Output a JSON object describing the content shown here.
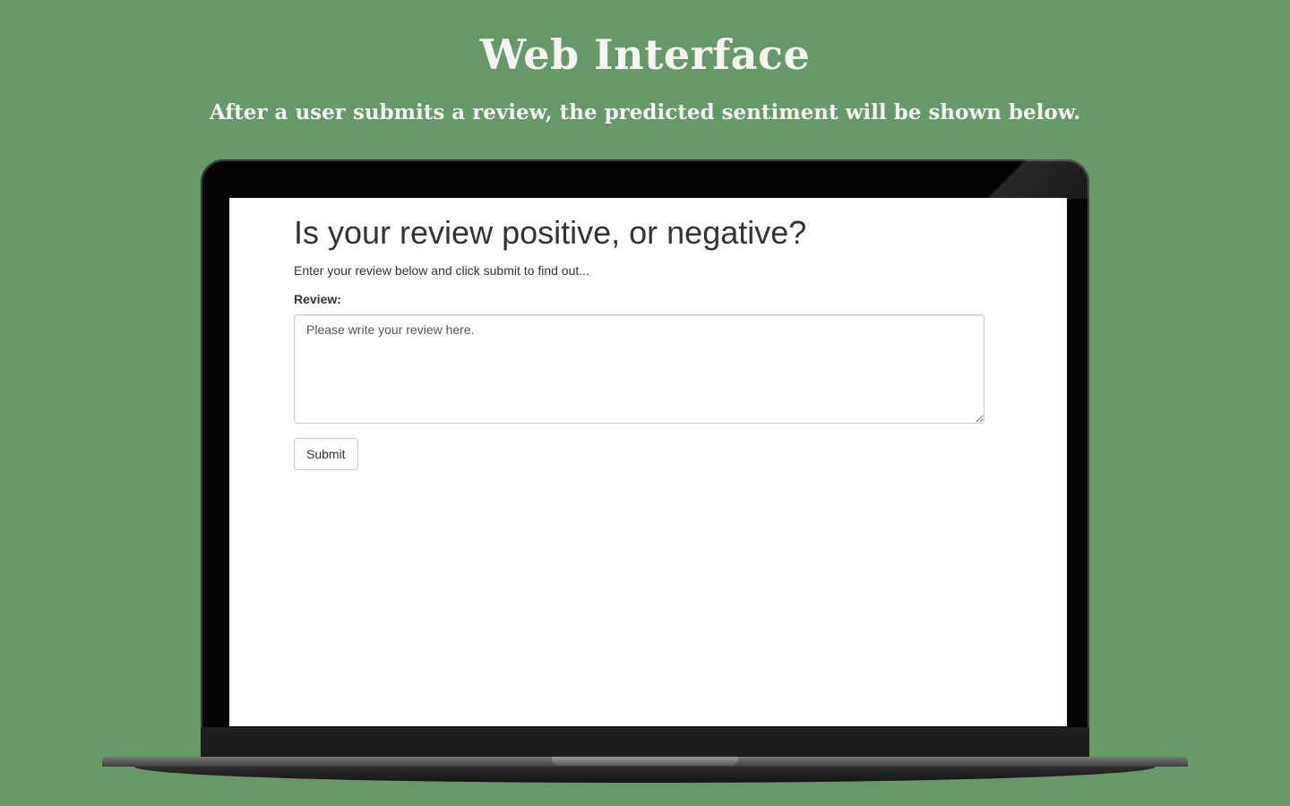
{
  "slide": {
    "title": "Web Interface",
    "subtitle": "After a user submits a review, the predicted sentiment will be shown below."
  },
  "page": {
    "heading": "Is your review positive, or negative?",
    "intro": "Enter your review below and click submit to find out...",
    "review_label": "Review:",
    "review_placeholder": "Please write your review here.",
    "submit_label": "Submit"
  },
  "colors": {
    "background": "#659a68",
    "laptop_bezel": "#050505",
    "screen": "#ffffff",
    "text": "#333333"
  }
}
